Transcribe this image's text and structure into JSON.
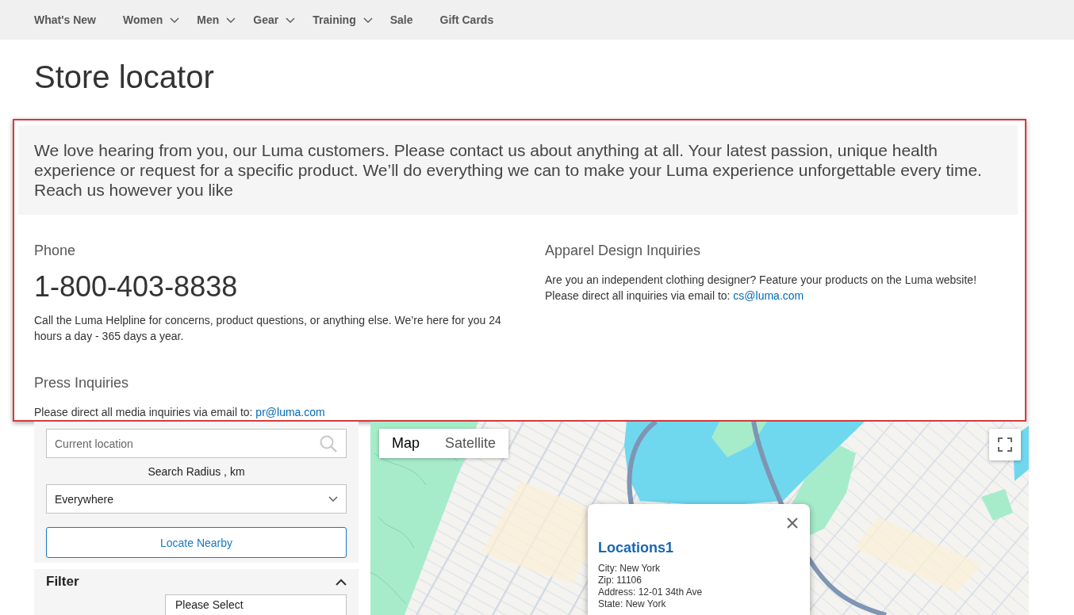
{
  "nav": {
    "items": [
      {
        "label": "What's New",
        "submenu": false
      },
      {
        "label": "Women",
        "submenu": true
      },
      {
        "label": "Men",
        "submenu": true
      },
      {
        "label": "Gear",
        "submenu": true
      },
      {
        "label": "Training",
        "submenu": true
      },
      {
        "label": "Sale",
        "submenu": false
      },
      {
        "label": "Gift Cards",
        "submenu": false
      }
    ]
  },
  "page_title": "Store locator",
  "contact_panel": {
    "intro": "We love hearing from you, our Luma customers. Please contact us about anything at all. Your latest passion, unique health experience or request for a specific product. We’ll do everything we can to make your Luma experience unforgettable every time. Reach us however you like",
    "columns": [
      {
        "sections": [
          {
            "kind": "phone",
            "heading": "Phone",
            "number": "1-800-403-8838",
            "text": "Call the Luma Helpline for concerns, product questions, or anything else. We’re here for you 24 hours a day - 365 days a year."
          },
          {
            "kind": "email",
            "heading": "Press Inquiries",
            "text": "Please direct all media inquiries via email to:",
            "email": "pr@luma.com"
          }
        ]
      },
      {
        "sections": [
          {
            "kind": "email",
            "heading": "Apparel Design Inquiries",
            "text": "Are you an independent clothing designer? Feature your products on the Luma website! Please direct all inquiries via email to:",
            "email": "cs@luma.com"
          }
        ]
      }
    ]
  },
  "locator": {
    "search": {
      "placeholder": "Current location"
    },
    "radius_label": "Search Radius , km",
    "radius_select": {
      "value": "Everywhere"
    },
    "locate_button": "Locate Nearby",
    "filter": {
      "title": "Filter",
      "expanded": true,
      "select": {
        "value": "Please Select"
      }
    }
  },
  "map": {
    "map_types": [
      {
        "label": "Map",
        "selected": true
      },
      {
        "label": "Satellite",
        "selected": false
      }
    ],
    "info_window": {
      "title": "Locations1",
      "lines": [
        "City: New York",
        "Zip: 11106",
        "Address: 12-01 34th Ave",
        "State: New York"
      ]
    }
  }
}
